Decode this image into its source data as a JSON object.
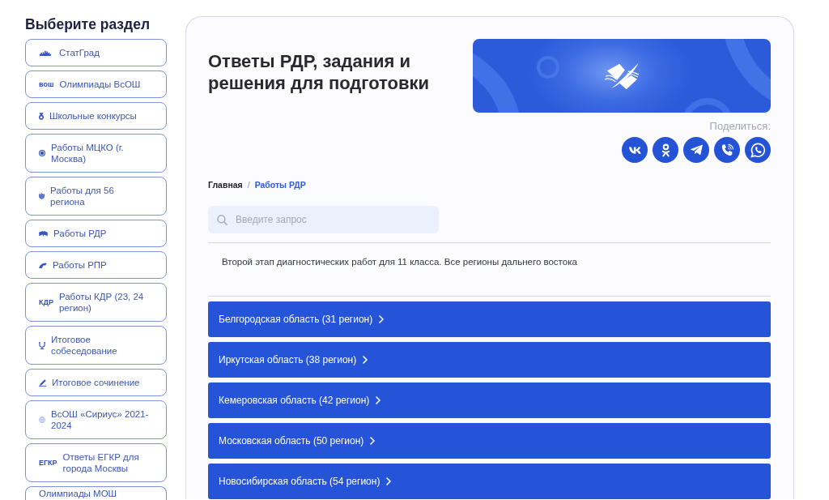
{
  "sidebar": {
    "title": "Выберите раздел",
    "items": [
      {
        "label": "СтатГрад",
        "kind": "skyline"
      },
      {
        "label": "Олимпиады ВсОШ",
        "kind": "text",
        "icon_text": "вош"
      },
      {
        "label": "Школьные конкурсы",
        "kind": "medal"
      },
      {
        "label": "Работы МЦКО (г. Москва)",
        "kind": "target"
      },
      {
        "label": "Работы для 56 региона",
        "kind": "crest"
      },
      {
        "label": "Работы РДР",
        "kind": "book"
      },
      {
        "label": "Работы РПР",
        "kind": "swoosh"
      },
      {
        "label": "Работы КДР (23, 24 регион)",
        "kind": "text",
        "icon_text": "КДР"
      },
      {
        "label": "Итоговое собеседование",
        "kind": "cup"
      },
      {
        "label": "Итоговое сочинение",
        "kind": "pen"
      },
      {
        "label": "ВсОШ «Сириус» 2021-2024",
        "kind": "globe"
      },
      {
        "label": "Ответы ЕГКР для города Москвы",
        "kind": "text",
        "icon_text": "ЕГКР"
      },
      {
        "label": "Олимпиады МОШ",
        "kind": "plain"
      }
    ]
  },
  "page": {
    "title": "Ответы РДР, задания и решения для подготовки",
    "share_label": "Поделиться:",
    "share_buttons": [
      {
        "kind": "vk"
      },
      {
        "kind": "ok"
      },
      {
        "kind": "telegram"
      },
      {
        "kind": "viber"
      },
      {
        "kind": "whatsapp"
      }
    ],
    "breadcrumb": {
      "items": [
        {
          "label": "Главная",
          "current": false
        },
        {
          "label": "Работы РДР",
          "current": true
        }
      ],
      "separator": "/"
    },
    "search": {
      "placeholder": "Введите запрос"
    },
    "description": "Второй этап диагностических работ для 11 класса. Все регионы дальнего востока",
    "regions": [
      {
        "label": "Белгородская область (31 регион)",
        "expanded": false
      },
      {
        "label": "Иркутская область (38 регион)",
        "expanded": false
      },
      {
        "label": "Кемеровская область (42 регион)",
        "expanded": false
      },
      {
        "label": "Московская область (50 регион)",
        "expanded": false
      },
      {
        "label": "Новосибирская область (54 регион)",
        "expanded": false
      }
    ]
  }
}
